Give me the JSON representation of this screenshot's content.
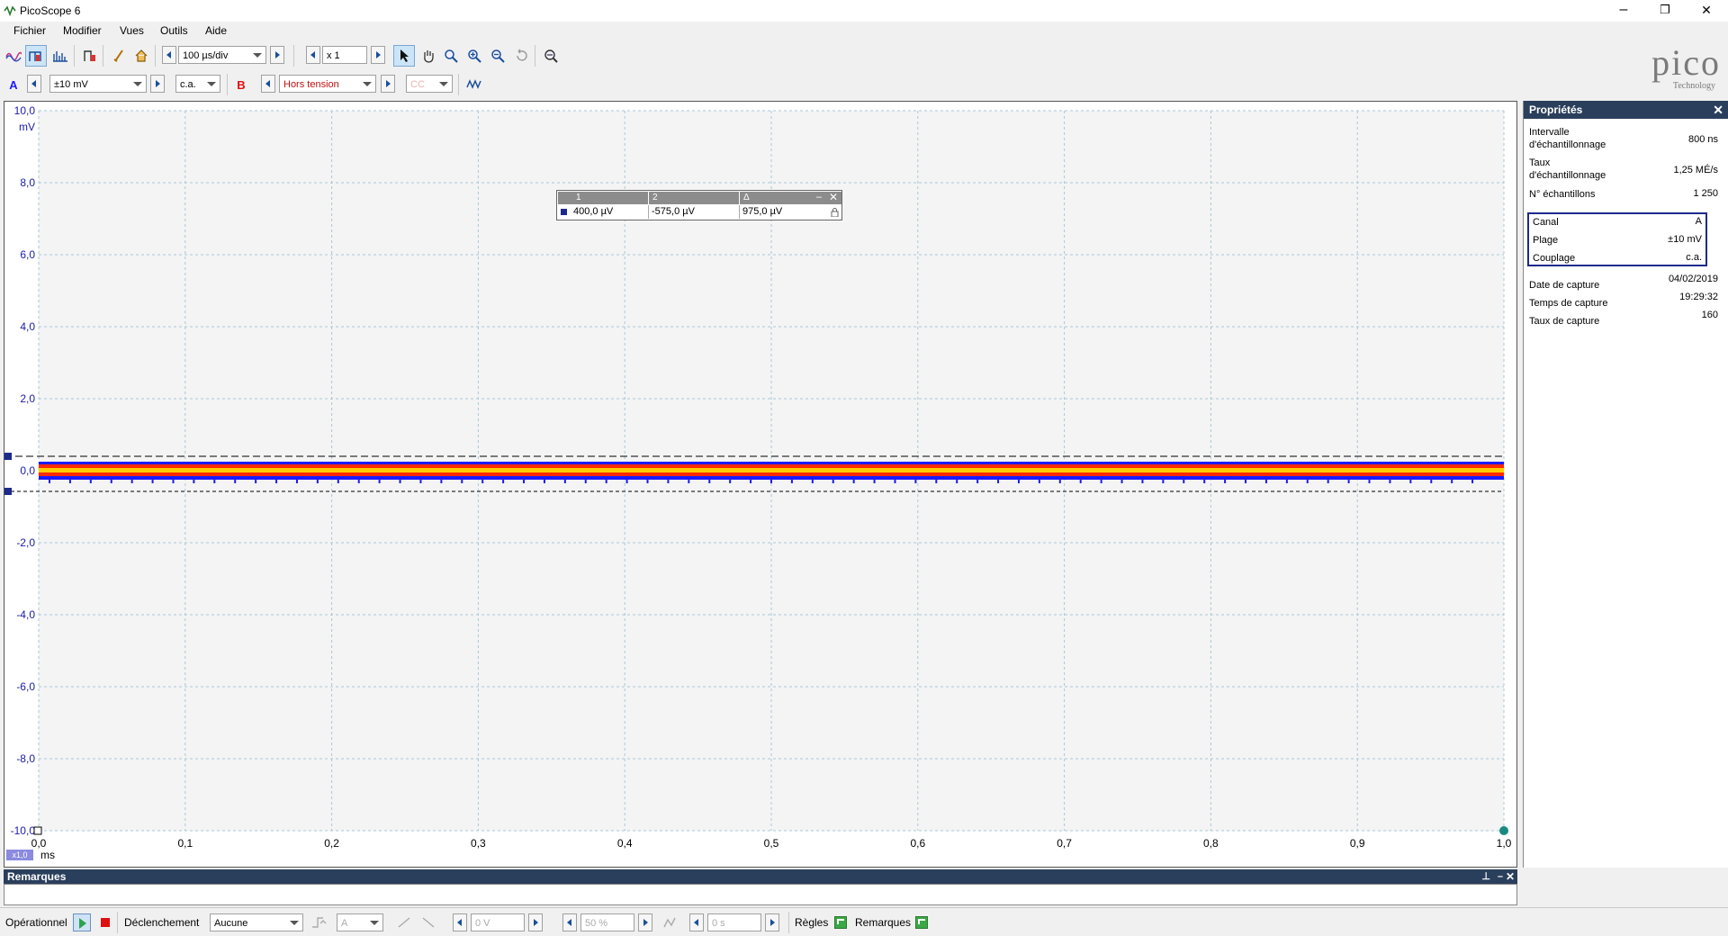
{
  "window": {
    "title": "PicoScope 6",
    "minimize": "–",
    "restore": "❐",
    "close": "✕"
  },
  "menu": [
    "Fichier",
    "Modifier",
    "Vues",
    "Outils",
    "Aide"
  ],
  "toolbar": {
    "timebase": "100 µs/div",
    "zoom": "x 1"
  },
  "channels": {
    "a_label": "A",
    "a_range": "±10 mV",
    "a_coupling": "c.a.",
    "b_label": "B",
    "b_range": "Hors tension",
    "b_coupling": "CC"
  },
  "logo": {
    "text": "pico",
    "sub": "Technology"
  },
  "scope": {
    "unit": "mV",
    "y_ticks": [
      "10,0",
      "8,0",
      "6,0",
      "4,0",
      "2,0",
      "0,0",
      "-2,0",
      "-4,0",
      "-6,0",
      "-8,0",
      "-10,0"
    ],
    "x_ticks": [
      "0,0",
      "0,1",
      "0,2",
      "0,3",
      "0,4",
      "0,5",
      "0,6",
      "0,7",
      "0,8",
      "0,9",
      "1,0"
    ],
    "x_unit": "ms",
    "x_zoom": "x1,0",
    "ruler1": 0.4,
    "ruler2": -0.575
  },
  "ruler_table": {
    "h1": "1",
    "h2": "2",
    "h3": "Δ",
    "v1": "400,0 µV",
    "v2": "-575,0 µV",
    "v3": "975,0 µV"
  },
  "properties": {
    "title": "Propriétés",
    "items": [
      {
        "label": "Intervalle\nd'échantillonnage",
        "value": "800 ns"
      },
      {
        "label": "Taux\nd'échantillonnage",
        "value": "1,25 MÉ/s"
      },
      {
        "label": "N° échantillons",
        "value": "1 250"
      }
    ],
    "channel": [
      {
        "label": "Canal",
        "value": "A"
      },
      {
        "label": "Plage",
        "value": "±10 mV"
      },
      {
        "label": "Couplage",
        "value": "c.a."
      }
    ],
    "capture": [
      {
        "label": "Date de capture",
        "value": "04/02/2019"
      },
      {
        "label": "Temps de capture",
        "value": "19:29:32"
      },
      {
        "label": "Taux de capture",
        "value": "160"
      }
    ]
  },
  "remarks": {
    "title": "Remarques"
  },
  "status": {
    "mode": "Opérationnel",
    "trigger_label": "Déclenchement",
    "trigger_value": "Aucune",
    "trig_channel": "A",
    "threshold": "0 V",
    "pretrigger": "50 %",
    "delay": "0 s",
    "rules": "Règles",
    "notes": "Remarques"
  },
  "colors": {
    "accent": "#2a3f5c",
    "trace_blue": "#1a1aff",
    "trace_red": "#ff2a00",
    "trace_yellow": "#ffd000"
  }
}
